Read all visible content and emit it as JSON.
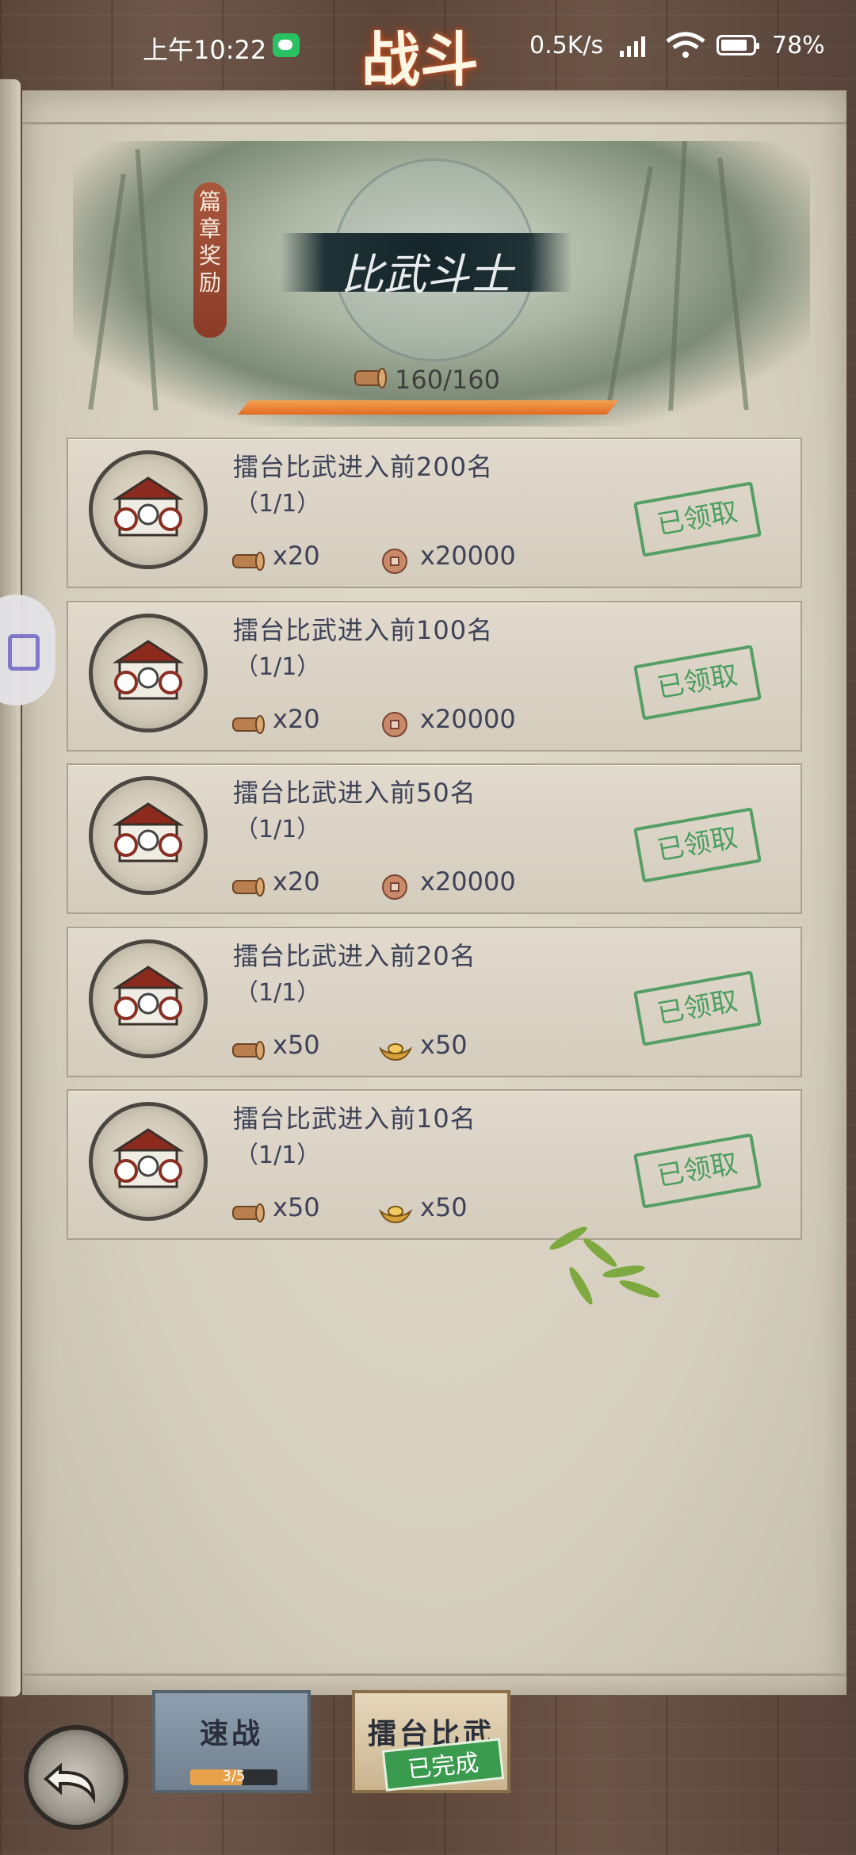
{
  "status_bar": {
    "time": "上午10:22",
    "screen_title": "战斗",
    "net_speed": "0.5K/s",
    "battery": "78%"
  },
  "chapter": {
    "side_tag": "篇章奖励",
    "title": "比武斗士",
    "progress_text": "160/160",
    "progress_fraction": 1.0
  },
  "tasks": [
    {
      "name": "擂台比武进入前200名",
      "count": "（1/1）",
      "rewards": [
        {
          "icon": "scroll-icon",
          "qty": "x20"
        },
        {
          "icon": "coin-icon",
          "qty": "x20000"
        }
      ],
      "status": "已领取"
    },
    {
      "name": "擂台比武进入前100名",
      "count": "（1/1）",
      "rewards": [
        {
          "icon": "scroll-icon",
          "qty": "x20"
        },
        {
          "icon": "coin-icon",
          "qty": "x20000"
        }
      ],
      "status": "已领取"
    },
    {
      "name": "擂台比武进入前50名",
      "count": "（1/1）",
      "rewards": [
        {
          "icon": "scroll-icon",
          "qty": "x20"
        },
        {
          "icon": "coin-icon",
          "qty": "x20000"
        }
      ],
      "status": "已领取"
    },
    {
      "name": "擂台比武进入前20名",
      "count": "（1/1）",
      "rewards": [
        {
          "icon": "scroll-icon",
          "qty": "x50"
        },
        {
          "icon": "gold-ingot-icon",
          "qty": "x50"
        }
      ],
      "status": "已领取"
    },
    {
      "name": "擂台比武进入前10名",
      "count": "（1/1）",
      "rewards": [
        {
          "icon": "scroll-icon",
          "qty": "x50"
        },
        {
          "icon": "gold-ingot-icon",
          "qty": "x50"
        }
      ],
      "status": "已领取"
    }
  ],
  "bottom": {
    "quick_label": "速战",
    "quick_progress": "3/5",
    "quick_fraction": 0.6,
    "arena_label": "擂台比武",
    "arena_badge": "已完成"
  }
}
